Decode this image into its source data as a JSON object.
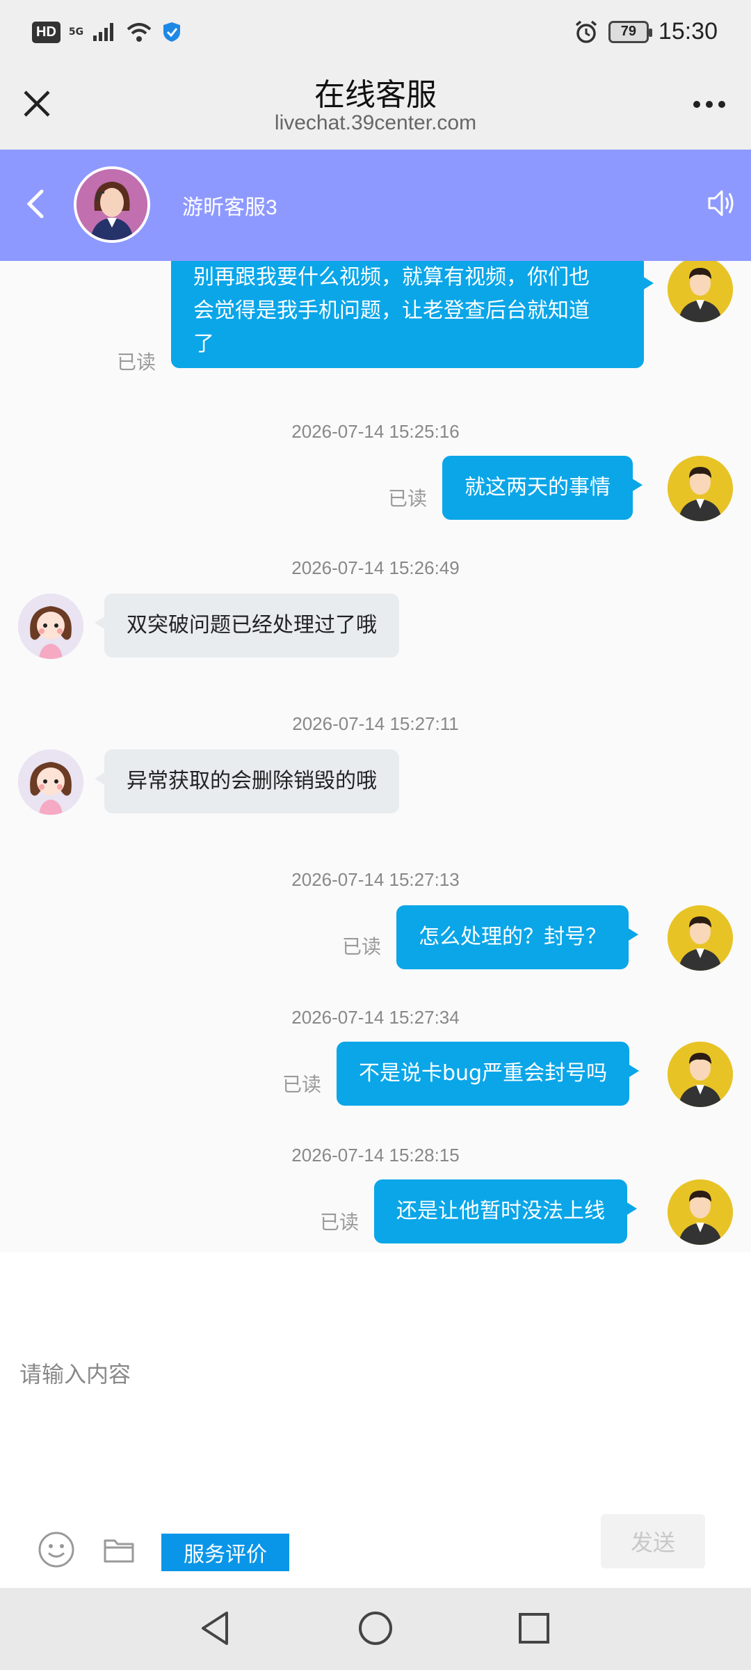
{
  "status_bar": {
    "hd_label": "HD",
    "network_label": "5G",
    "battery": "79",
    "time": "15:30"
  },
  "title_bar": {
    "title": "在线客服",
    "url": "livechat.39center.com"
  },
  "agent": {
    "name": "游昕客服3"
  },
  "chat": {
    "read_label": "已读",
    "messages": [
      {
        "from": "user",
        "text_lines": [
          "别再跟我要什么视频，就算有视频，你们也",
          "会觉得是我手机问题，让老登查后台就知道",
          "了"
        ],
        "status": "已读"
      },
      {
        "timestamp": "2026-07-14 15:25:16",
        "from": "user",
        "text": "就这两天的事情",
        "status": "已读"
      },
      {
        "timestamp": "2026-07-14 15:26:49",
        "from": "agent",
        "text": "双突破问题已经处理过了哦"
      },
      {
        "timestamp": "2026-07-14 15:27:11",
        "from": "agent",
        "text": "异常获取的会删除销毁的哦"
      },
      {
        "timestamp": "2026-07-14 15:27:13",
        "from": "user",
        "text": "怎么处理的？封号？",
        "status": "已读"
      },
      {
        "timestamp": "2026-07-14 15:27:34",
        "from": "user",
        "text": "不是说卡bug严重会封号吗",
        "status": "已读"
      },
      {
        "timestamp": "2026-07-14 15:28:15",
        "from": "user",
        "text": "还是让他暂时没法上线",
        "status": "已读"
      }
    ]
  },
  "input": {
    "placeholder": "请输入内容",
    "rate_label": "服务评价",
    "send_label": "发送"
  },
  "colors": {
    "header_bg": "#8e99ff",
    "user_bubble": "#0aa6e8",
    "agent_bubble": "#e8ecef",
    "rate_button": "#0a96e8"
  },
  "icons": [
    "close-icon",
    "more-icon",
    "back-icon",
    "speaker-icon",
    "emoji-icon",
    "folder-icon",
    "nav-back-icon",
    "nav-home-icon",
    "nav-recent-icon"
  ]
}
